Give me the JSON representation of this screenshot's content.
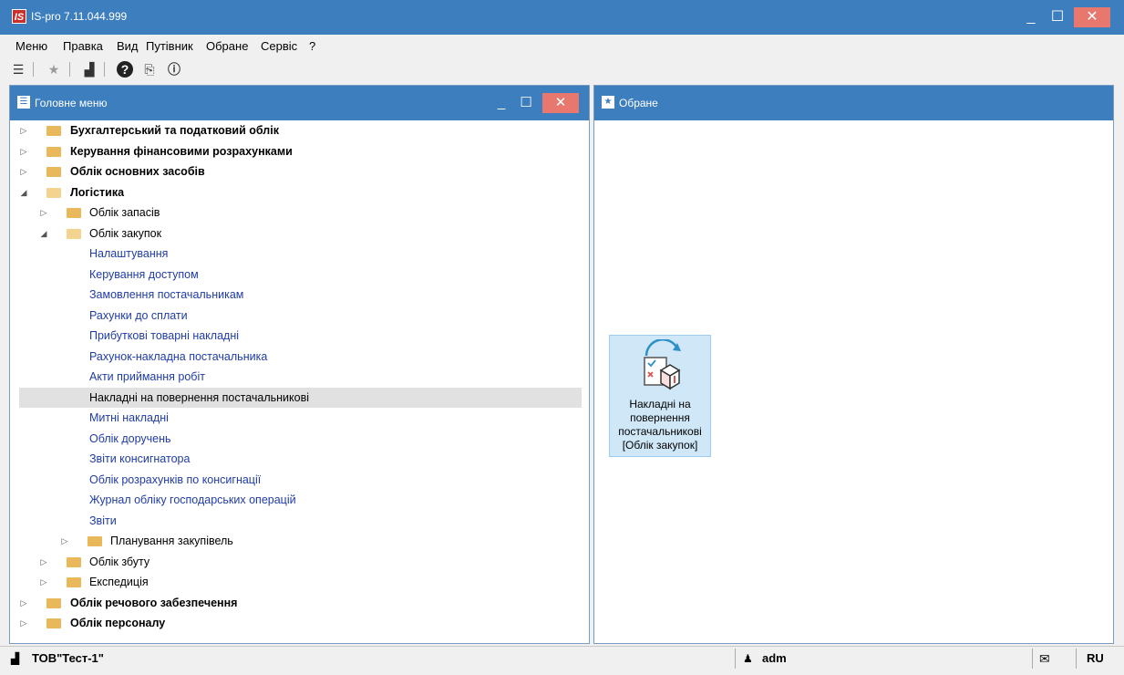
{
  "window": {
    "logo": "IS",
    "title": "IS-pro 7.11.044.999",
    "min_glyph": "_",
    "max_glyph": "☐",
    "close_glyph": "✕"
  },
  "menu": [
    "Меню",
    "Правка",
    "Вид",
    "Путівник",
    "Обране",
    "Сервіс",
    "?"
  ],
  "toolbar": {
    "icons": [
      "menu-list-icon",
      "star-icon",
      "chart-icon",
      "help-icon",
      "document-settings-icon",
      "info-icon"
    ],
    "glyphs": [
      "☰",
      "★",
      "▟",
      "?",
      "⎘",
      "ⓘ"
    ]
  },
  "left_panel": {
    "title": "Головне меню",
    "min_glyph": "_",
    "max_glyph": "☐",
    "close_glyph": "✕",
    "items": [
      {
        "label": "Бухгалтерський та податковий облік",
        "level": 0,
        "type": "folder",
        "expanded": false,
        "style": "bold"
      },
      {
        "label": "Керування фінансовими розрахунками",
        "level": 0,
        "type": "folder",
        "expanded": false,
        "style": "bold"
      },
      {
        "label": "Облік основних засобів",
        "level": 0,
        "type": "folder",
        "expanded": false,
        "style": "bold"
      },
      {
        "label": "Логістика",
        "level": 0,
        "type": "folder",
        "expanded": true,
        "style": "bold"
      },
      {
        "label": "Облік запасів",
        "level": 1,
        "type": "folder",
        "expanded": false,
        "style": "normal"
      },
      {
        "label": "Облік закупок",
        "level": 1,
        "type": "folder",
        "expanded": true,
        "style": "normal"
      },
      {
        "label": "Налаштування",
        "level": 2,
        "type": "link",
        "style": "link"
      },
      {
        "label": "Керування доступом",
        "level": 2,
        "type": "link",
        "style": "link"
      },
      {
        "label": "Замовлення постачальникам",
        "level": 2,
        "type": "link",
        "style": "link"
      },
      {
        "label": "Рахунки до сплати",
        "level": 2,
        "type": "link",
        "style": "link"
      },
      {
        "label": "Прибуткові товарні накладні",
        "level": 2,
        "type": "link",
        "style": "link"
      },
      {
        "label": "Рахунок-накладна постачальника",
        "level": 2,
        "type": "link",
        "style": "link"
      },
      {
        "label": "Акти приймання робіт",
        "level": 2,
        "type": "link",
        "style": "link"
      },
      {
        "label": "Накладні на повернення постачальникові",
        "level": 2,
        "type": "link",
        "style": "normal",
        "selected": true
      },
      {
        "label": "Митні накладні",
        "level": 2,
        "type": "link",
        "style": "link"
      },
      {
        "label": "Облік доручень",
        "level": 2,
        "type": "link",
        "style": "link"
      },
      {
        "label": "Звіти консигнатора",
        "level": 2,
        "type": "link",
        "style": "link"
      },
      {
        "label": "Облік розрахунків по консигнації",
        "level": 2,
        "type": "link",
        "style": "link"
      },
      {
        "label": "Журнал обліку господарських операцій",
        "level": 2,
        "type": "link",
        "style": "link"
      },
      {
        "label": "Звіти",
        "level": 2,
        "type": "link",
        "style": "link"
      },
      {
        "label": "Планування закупівель",
        "level": 2,
        "type": "folder",
        "expanded": false,
        "style": "normal"
      },
      {
        "label": "Облік збуту",
        "level": 1,
        "type": "folder",
        "expanded": false,
        "style": "normal"
      },
      {
        "label": "Експедиція",
        "level": 1,
        "type": "folder",
        "expanded": false,
        "style": "normal"
      },
      {
        "label": "Облік речового забезпечення",
        "level": 0,
        "type": "folder",
        "expanded": false,
        "style": "bold"
      },
      {
        "label": "Облік персоналу",
        "level": 0,
        "type": "folder",
        "expanded": false,
        "style": "bold"
      }
    ]
  },
  "right_panel": {
    "title": "Обране",
    "tile": {
      "icon": "return-box-icon",
      "line1": "Накладні на",
      "line2": "повернення",
      "line3": "постачальникові",
      "line4": "[Облік закупок]"
    }
  },
  "status": {
    "company": "ТОВ\"Тест-1\"",
    "user": "adm",
    "mail_icon": "envelope-icon",
    "lang": "RU"
  }
}
